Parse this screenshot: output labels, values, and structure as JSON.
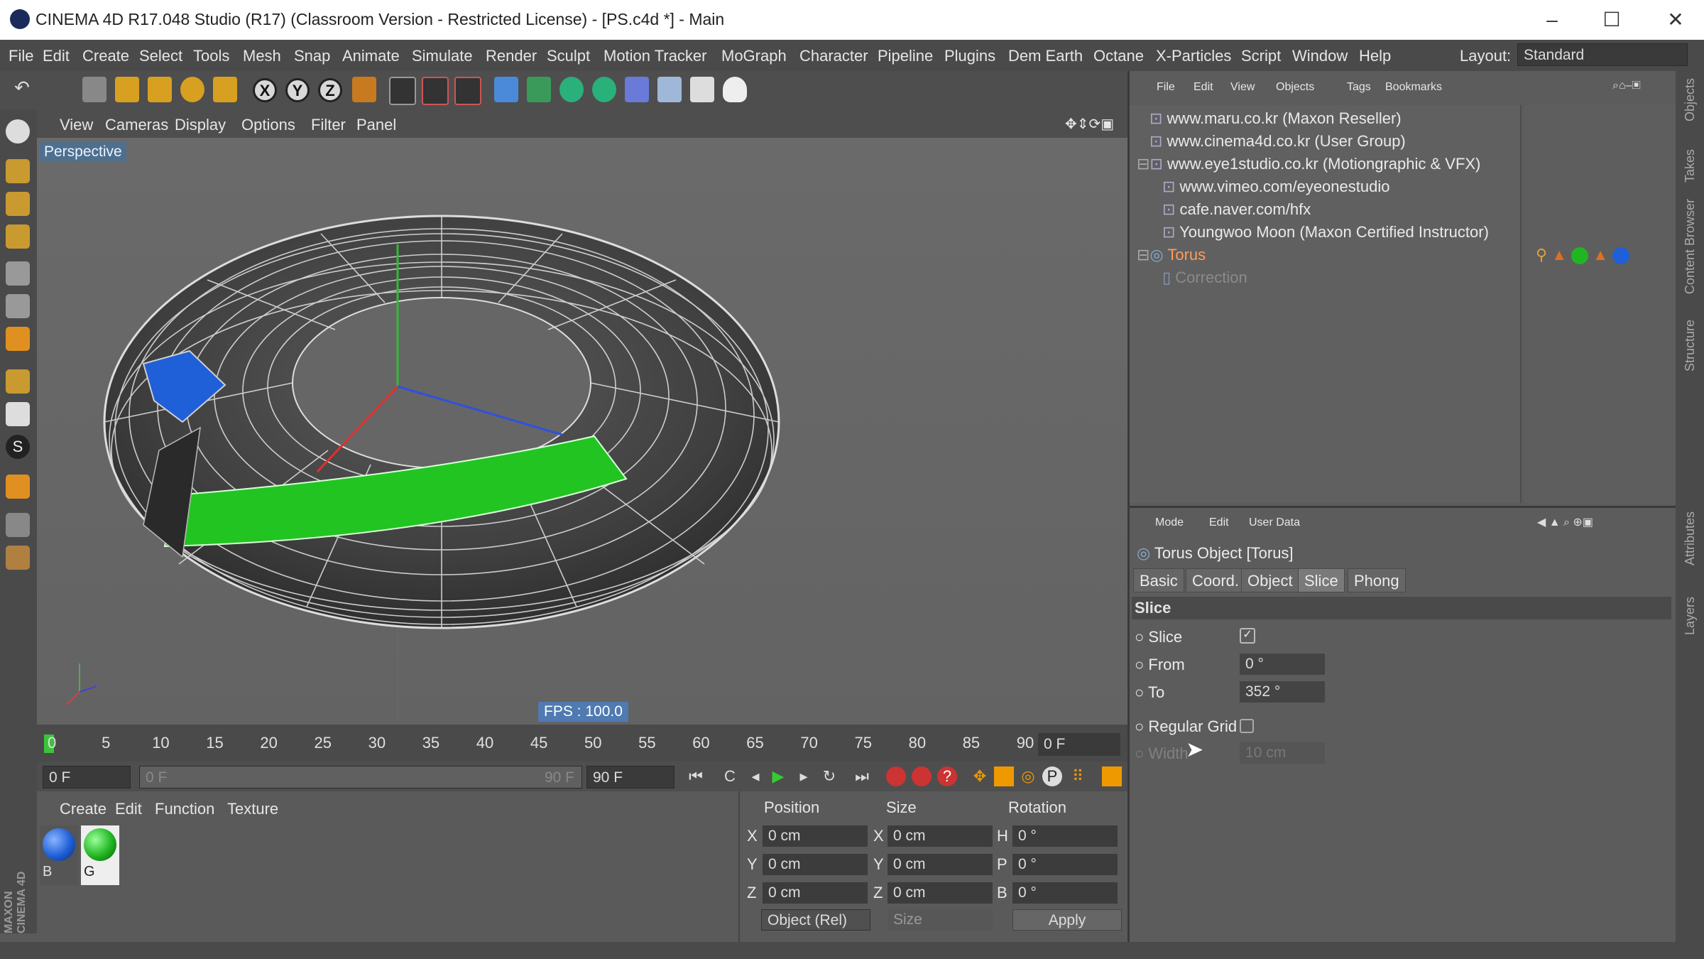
{
  "window": {
    "title": "CINEMA 4D R17.048 Studio (R17) (Classroom Version - Restricted License) - [PS.c4d *] - Main"
  },
  "menu": [
    "File",
    "Edit",
    "Create",
    "Select",
    "Tools",
    "Mesh",
    "Snap",
    "Animate",
    "Simulate",
    "Render",
    "Sculpt",
    "Motion Tracker",
    "MoGraph",
    "Character",
    "Pipeline",
    "Plugins",
    "Dem Earth",
    "Octane",
    "X-Particles",
    "Script",
    "Window",
    "Help"
  ],
  "layout": {
    "label": "Layout:",
    "value": "Standard"
  },
  "viewport": {
    "menu": [
      "View",
      "Cameras",
      "Display",
      "Options",
      "Filter",
      "Panel"
    ],
    "camera": "Perspective",
    "fps": "FPS : 100.0"
  },
  "timeline": {
    "ticks": [
      "0",
      "5",
      "10",
      "15",
      "20",
      "25",
      "30",
      "35",
      "40",
      "45",
      "50",
      "55",
      "60",
      "65",
      "70",
      "75",
      "80",
      "85",
      "90"
    ],
    "current": "0 F"
  },
  "transport": {
    "start": "0 F",
    "range_start": "0 F",
    "range_end": "90 F",
    "end": "90 F"
  },
  "materials": {
    "menu": [
      "Create",
      "Edit",
      "Function",
      "Texture"
    ],
    "items": [
      {
        "name": "B",
        "color": "#1f5fd8"
      },
      {
        "name": "G",
        "color": "#22b522"
      }
    ]
  },
  "coords": {
    "headers": [
      "Position",
      "Size",
      "Rotation"
    ],
    "rows": [
      {
        "axis": "X",
        "pos": "0 cm",
        "size_axis": "X",
        "size": "0 cm",
        "rot_axis": "H",
        "rot": "0 °"
      },
      {
        "axis": "Y",
        "pos": "0 cm",
        "size_axis": "Y",
        "size": "0 cm",
        "rot_axis": "P",
        "rot": "0 °"
      },
      {
        "axis": "Z",
        "pos": "0 cm",
        "size_axis": "Z",
        "size": "0 cm",
        "rot_axis": "B",
        "rot": "0 °"
      }
    ],
    "mode": "Object (Rel)",
    "size_mode": "Size",
    "apply": "Apply"
  },
  "objects": {
    "menu": [
      "File",
      "Edit",
      "View",
      "Objects",
      "Tags",
      "Bookmarks"
    ],
    "items": [
      {
        "name": "www.maru.co.kr (Maxon Reseller)"
      },
      {
        "name": "www.cinema4d.co.kr (User Group)"
      },
      {
        "name": "www.eye1studio.co.kr (Motiongraphic & VFX)"
      },
      {
        "name": "www.vimeo.com/eyeonestudio"
      },
      {
        "name": "cafe.naver.com/hfx"
      },
      {
        "name": "Youngwoo Moon (Maxon Certified Instructor)"
      },
      {
        "name": "Torus"
      },
      {
        "name": "Correction"
      }
    ]
  },
  "attributes": {
    "menu": [
      "Mode",
      "Edit",
      "User Data"
    ],
    "object_title": "Torus Object [Torus]",
    "tabs": [
      "Basic",
      "Coord.",
      "Object",
      "Slice",
      "Phong"
    ],
    "active_tab": "Slice",
    "section": "Slice",
    "fields": {
      "slice_label": "Slice",
      "from_label": "From",
      "from_value": "0 °",
      "to_label": "To",
      "to_value": "352 °",
      "grid_label": "Regular Grid",
      "width_label": "Width",
      "width_value": "10 cm"
    }
  },
  "side_tabs": [
    "Objects",
    "Takes",
    "Content Browser",
    "Structure",
    "Attributes",
    "Layers"
  ],
  "brand": "MAXON CINEMA 4D"
}
